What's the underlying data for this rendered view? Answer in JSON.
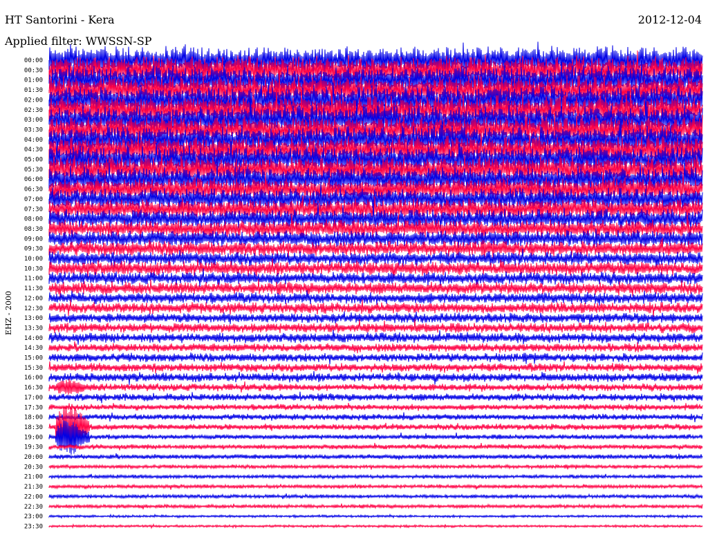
{
  "header": {
    "title": "HT Santorini - Kera",
    "date": "2012-12-04",
    "filter": "Applied filter: WWSSN-SP"
  },
  "chart_data": {
    "type": "line",
    "title": "HT Santorini - Kera",
    "ylabel": "EHZ - 2000",
    "row_labels": [
      "00:00",
      "00:30",
      "01:00",
      "01:30",
      "02:00",
      "02:30",
      "03:00",
      "03:30",
      "04:00",
      "04:30",
      "05:00",
      "05:30",
      "06:00",
      "06:30",
      "07:00",
      "07:30",
      "08:00",
      "08:30",
      "09:00",
      "09:30",
      "10:00",
      "10:30",
      "11:00",
      "11:30",
      "12:00",
      "12:30",
      "13:00",
      "13:30",
      "14:00",
      "14:30",
      "15:00",
      "15:30",
      "16:00",
      "16:30",
      "17:00",
      "17:30",
      "18:00",
      "18:30",
      "19:00",
      "19:30",
      "20:00",
      "20:30",
      "21:00",
      "21:30",
      "22:00",
      "22:30",
      "23:00",
      "23:30"
    ],
    "colors": [
      "#0000e6",
      "#ff0044"
    ],
    "row_amplitude": [
      22,
      22,
      22,
      22,
      22,
      22,
      22,
      21,
      21,
      21,
      20,
      20,
      19,
      18,
      17,
      16,
      15,
      14,
      13,
      12,
      11,
      11,
      10,
      10,
      9,
      9,
      8,
      8,
      8,
      7,
      7,
      7,
      7,
      6,
      6,
      5,
      5,
      5,
      4,
      4,
      4,
      3,
      3,
      3,
      3,
      3,
      2,
      2
    ],
    "events": [
      {
        "row": "18:30",
        "label": "",
        "amplitude": 36
      },
      {
        "row": "19:00",
        "label": "",
        "amplitude": 30
      },
      {
        "row": "16:30",
        "label": "",
        "amplitude": 14
      }
    ]
  }
}
